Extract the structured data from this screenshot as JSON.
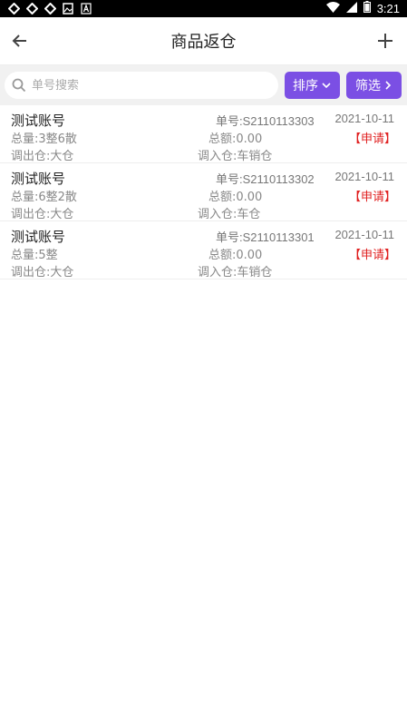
{
  "status_bar": {
    "time": "3:21",
    "left_icons": [
      "app-icon",
      "app-icon",
      "app-icon",
      "image-icon",
      "text-icon"
    ],
    "right_icons": [
      "wifi-icon",
      "signal-icon",
      "battery-icon"
    ]
  },
  "header": {
    "title": "商品返仓",
    "back_icon": "back-arrow-icon",
    "add_icon": "plus-icon"
  },
  "search": {
    "placeholder": "单号搜索",
    "sort_label": "排序",
    "filter_label": "筛选"
  },
  "colors": {
    "accent": "#7b4fe4",
    "status": "#e02020"
  },
  "items": [
    {
      "name": "测试账号",
      "no": "单号:S2110113303",
      "date": "2021-10-11",
      "qty": "总量:3整6散",
      "amount": "总额:0.00",
      "status": "【申请】",
      "out": "调出仓:大仓",
      "in": "调入仓:车销仓"
    },
    {
      "name": "测试账号",
      "no": "单号:S2110113302",
      "date": "2021-10-11",
      "qty": "总量:6整2散",
      "amount": "总额:0.00",
      "status": "【申请】",
      "out": "调出仓:大仓",
      "in": "调入仓:车仓"
    },
    {
      "name": "测试账号",
      "no": "单号:S2110113301",
      "date": "2021-10-11",
      "qty": "总量:5整",
      "amount": "总额:0.00",
      "status": "【申请】",
      "out": "调出仓:大仓",
      "in": "调入仓:车销仓"
    }
  ]
}
